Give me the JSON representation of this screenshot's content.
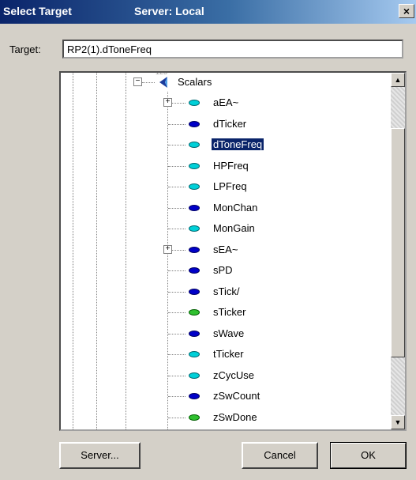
{
  "window": {
    "title": "Select Target",
    "server_caption": "Server: Local",
    "close_glyph": "×"
  },
  "target": {
    "label": "Target:",
    "value": "RP2(1).dToneFreq"
  },
  "tree": {
    "badge": "123",
    "root_label": "Scalars",
    "selected": "dToneFreq",
    "items": [
      {
        "label": "aEA~",
        "color": "cyan",
        "expandable": true
      },
      {
        "label": "dTicker",
        "color": "blue",
        "expandable": false
      },
      {
        "label": "dToneFreq",
        "color": "cyan",
        "expandable": false
      },
      {
        "label": "HPFreq",
        "color": "cyan",
        "expandable": false
      },
      {
        "label": "LPFreq",
        "color": "cyan",
        "expandable": false
      },
      {
        "label": "MonChan",
        "color": "blue",
        "expandable": false
      },
      {
        "label": "MonGain",
        "color": "cyan",
        "expandable": false
      },
      {
        "label": "sEA~",
        "color": "blue",
        "expandable": true
      },
      {
        "label": "sPD",
        "color": "blue",
        "expandable": false
      },
      {
        "label": "sTick/",
        "color": "blue",
        "expandable": false
      },
      {
        "label": "sTicker",
        "color": "green",
        "expandable": false
      },
      {
        "label": "sWave",
        "color": "blue",
        "expandable": false
      },
      {
        "label": "tTicker",
        "color": "cyan",
        "expandable": false
      },
      {
        "label": "zCycUse",
        "color": "cyan",
        "expandable": false
      },
      {
        "label": "zSwCount",
        "color": "blue",
        "expandable": false
      },
      {
        "label": "zSwDone",
        "color": "green",
        "expandable": false
      }
    ]
  },
  "colors": {
    "cyan": "#00d0d8",
    "blue": "#0000c8",
    "green": "#30c030",
    "selection": "#0a246a"
  },
  "buttons": {
    "server": "Server...",
    "cancel": "Cancel",
    "ok": "OK"
  }
}
